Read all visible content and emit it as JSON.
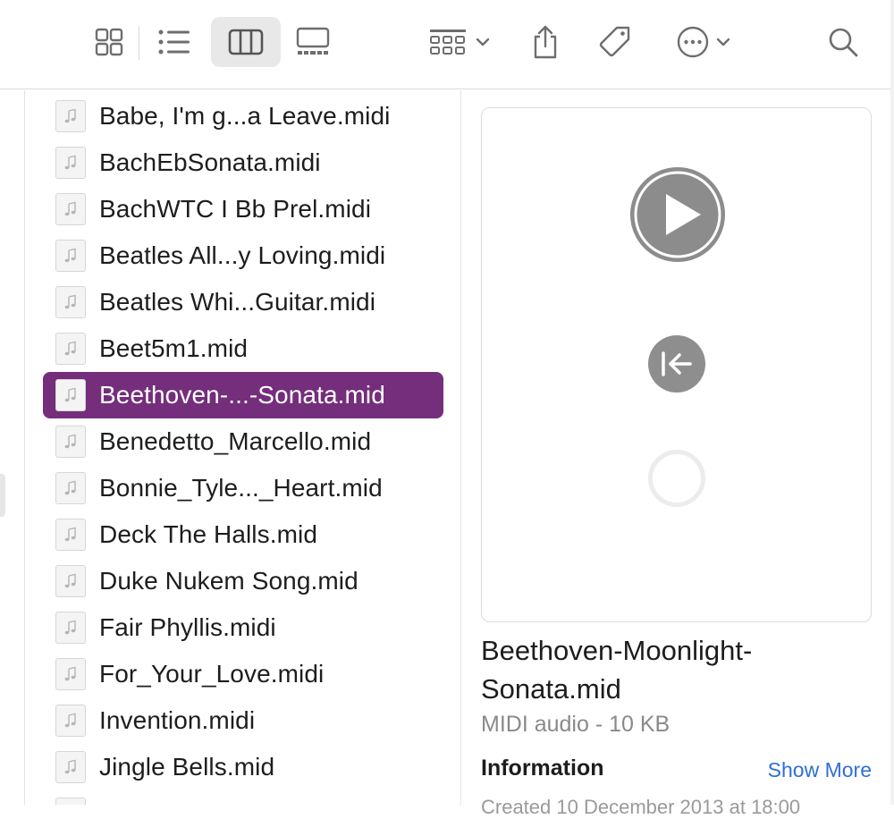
{
  "toolbar": {
    "view_buttons": [
      "icon-view",
      "list-view",
      "column-view",
      "gallery-view"
    ],
    "active_view": "column-view",
    "actions": [
      "group-by",
      "share",
      "tags",
      "more-actions",
      "search"
    ]
  },
  "files": [
    {
      "name": "Babe, I'm g...a Leave.midi"
    },
    {
      "name": "BachEbSonata.midi"
    },
    {
      "name": "BachWTC I Bb Prel.midi"
    },
    {
      "name": "Beatles All...y Loving.midi"
    },
    {
      "name": "Beatles Whi...Guitar.midi"
    },
    {
      "name": "Beet5m1.mid"
    },
    {
      "name": "Beethoven-...-Sonata.mid",
      "selected": true
    },
    {
      "name": "Benedetto_Marcello.mid"
    },
    {
      "name": "Bonnie_Tyle..._Heart.mid"
    },
    {
      "name": "Deck The Halls.mid"
    },
    {
      "name": "Duke Nukem Song.mid"
    },
    {
      "name": "Fair Phyllis.midi"
    },
    {
      "name": "For_Your_Love.midi"
    },
    {
      "name": "Invention.midi"
    },
    {
      "name": "Jingle Bells.mid"
    }
  ],
  "preview": {
    "title_line1": "Beethoven-Moonlight-",
    "title_line2": "Sonata.mid",
    "subtitle": "MIDI audio - 10 KB",
    "info_heading": "Information",
    "show_more": "Show More",
    "partial_row": "Created   10 December 2013 at 18:00"
  },
  "colors": {
    "selection": "#742e7b",
    "link": "#2f6fd6",
    "icon_gray": "#6e6e6e"
  }
}
